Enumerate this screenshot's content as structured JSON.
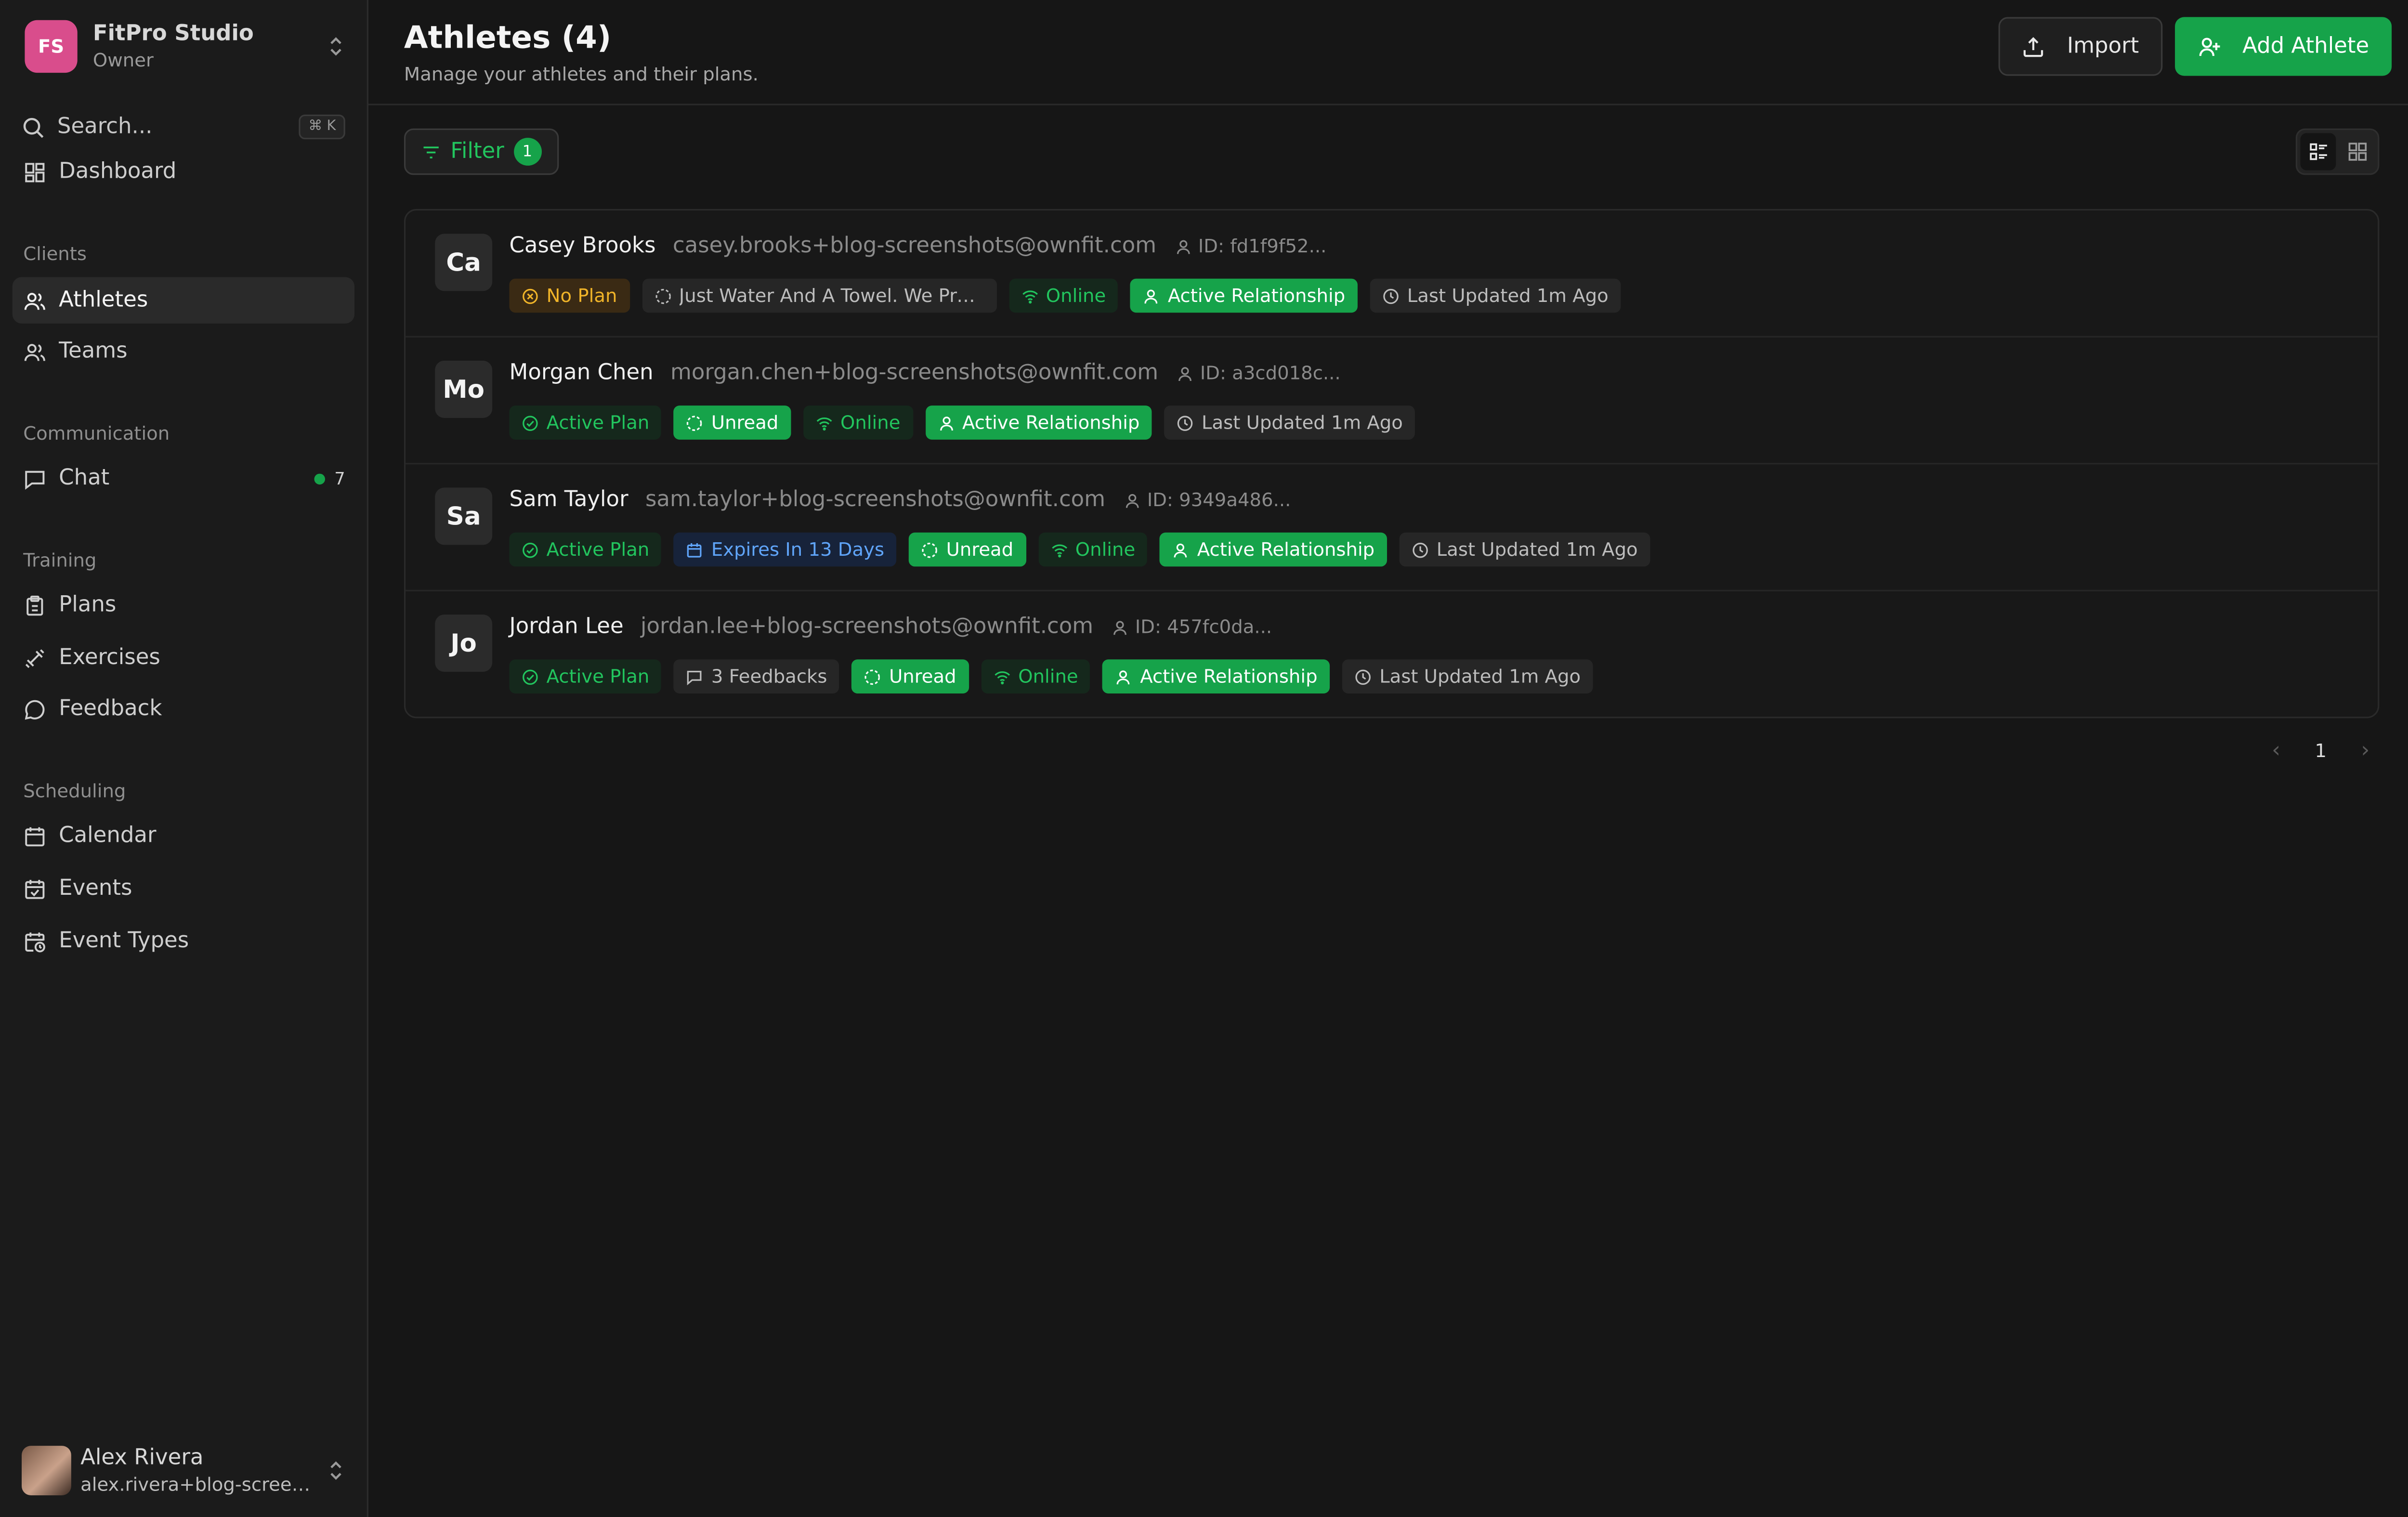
{
  "org": {
    "initials": "FS",
    "name": "FitPro Studio",
    "role": "Owner"
  },
  "search": {
    "label": "Search...",
    "shortcut": "⌘ K"
  },
  "nav": {
    "dashboard": "Dashboard",
    "sections": {
      "clients": "Clients",
      "communication": "Communication",
      "training": "Training",
      "scheduling": "Scheduling"
    },
    "athletes": "Athletes",
    "teams": "Teams",
    "chat": "Chat",
    "chat_count": "7",
    "plans": "Plans",
    "exercises": "Exercises",
    "feedback": "Feedback",
    "calendar": "Calendar",
    "events": "Events",
    "event_types": "Event Types"
  },
  "user": {
    "name": "Alex Rivera",
    "email": "alex.rivera+blog-screenshots@ownfit.com"
  },
  "header": {
    "title": "Athletes (4)",
    "subtitle": "Manage your athletes and their plans.",
    "import_label": "Import",
    "add_label": "Add Athlete"
  },
  "filter": {
    "label": "Filter",
    "count": "1"
  },
  "athletes": [
    {
      "initials": "Ca",
      "name": "Casey Brooks",
      "email": "casey.brooks+blog-screenshots@ownfit.com",
      "id": "ID: fd1f9f52...",
      "badges": {
        "plan": "No Plan",
        "note": "Just Water And A Towel. We Pro...",
        "online": "Online",
        "relationship": "Active Relationship",
        "updated": "Last Updated 1m Ago"
      }
    },
    {
      "initials": "Mo",
      "name": "Morgan Chen",
      "email": "morgan.chen+blog-screenshots@ownfit.com",
      "id": "ID: a3cd018c...",
      "badges": {
        "plan": "Active Plan",
        "unread": "Unread",
        "online": "Online",
        "relationship": "Active Relationship",
        "updated": "Last Updated 1m Ago"
      }
    },
    {
      "initials": "Sa",
      "name": "Sam Taylor",
      "email": "sam.taylor+blog-screenshots@ownfit.com",
      "id": "ID: 9349a486...",
      "badges": {
        "plan": "Active Plan",
        "expires": "Expires In 13 Days",
        "unread": "Unread",
        "online": "Online",
        "relationship": "Active Relationship",
        "updated": "Last Updated 1m Ago"
      }
    },
    {
      "initials": "Jo",
      "name": "Jordan Lee",
      "email": "jordan.lee+blog-screenshots@ownfit.com",
      "id": "ID: 457fc0da...",
      "badges": {
        "plan": "Active Plan",
        "feedbacks": "3 Feedbacks",
        "unread": "Unread",
        "online": "Online",
        "relationship": "Active Relationship",
        "updated": "Last Updated 1m Ago"
      }
    }
  ],
  "pagination": {
    "current": "1"
  },
  "colors": {
    "accent": "#16a34a",
    "org_logo": "#d94d8c",
    "warning": "#f0b429",
    "info": "#60a5fa",
    "background": "#161616"
  }
}
